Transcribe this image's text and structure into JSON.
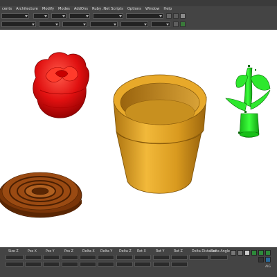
{
  "menu": {
    "items": [
      "cents",
      "Architecture",
      "Modify",
      "Modes",
      "AddOns",
      "Ruby .Net Scripts",
      "Options",
      "Window",
      "Help"
    ]
  },
  "status_columns": [
    "Size Z",
    "Pos X",
    "Pos Y",
    "Pos Z",
    "Delta X",
    "Delta Y",
    "Delta Z",
    "Rot X",
    "Rot Y",
    "Rot Z",
    "Delta Distance",
    "Delta Angle"
  ],
  "status_right_text": "AIG",
  "colors": {
    "chrome": "#444444",
    "rose": "#e81010",
    "pot": "#d99a1f",
    "base": "#8a3e0c",
    "stem": "#22e022"
  },
  "viewport": {
    "objects": [
      "rose-head",
      "flower-pot",
      "coaster-disc",
      "stem-leaves"
    ]
  }
}
